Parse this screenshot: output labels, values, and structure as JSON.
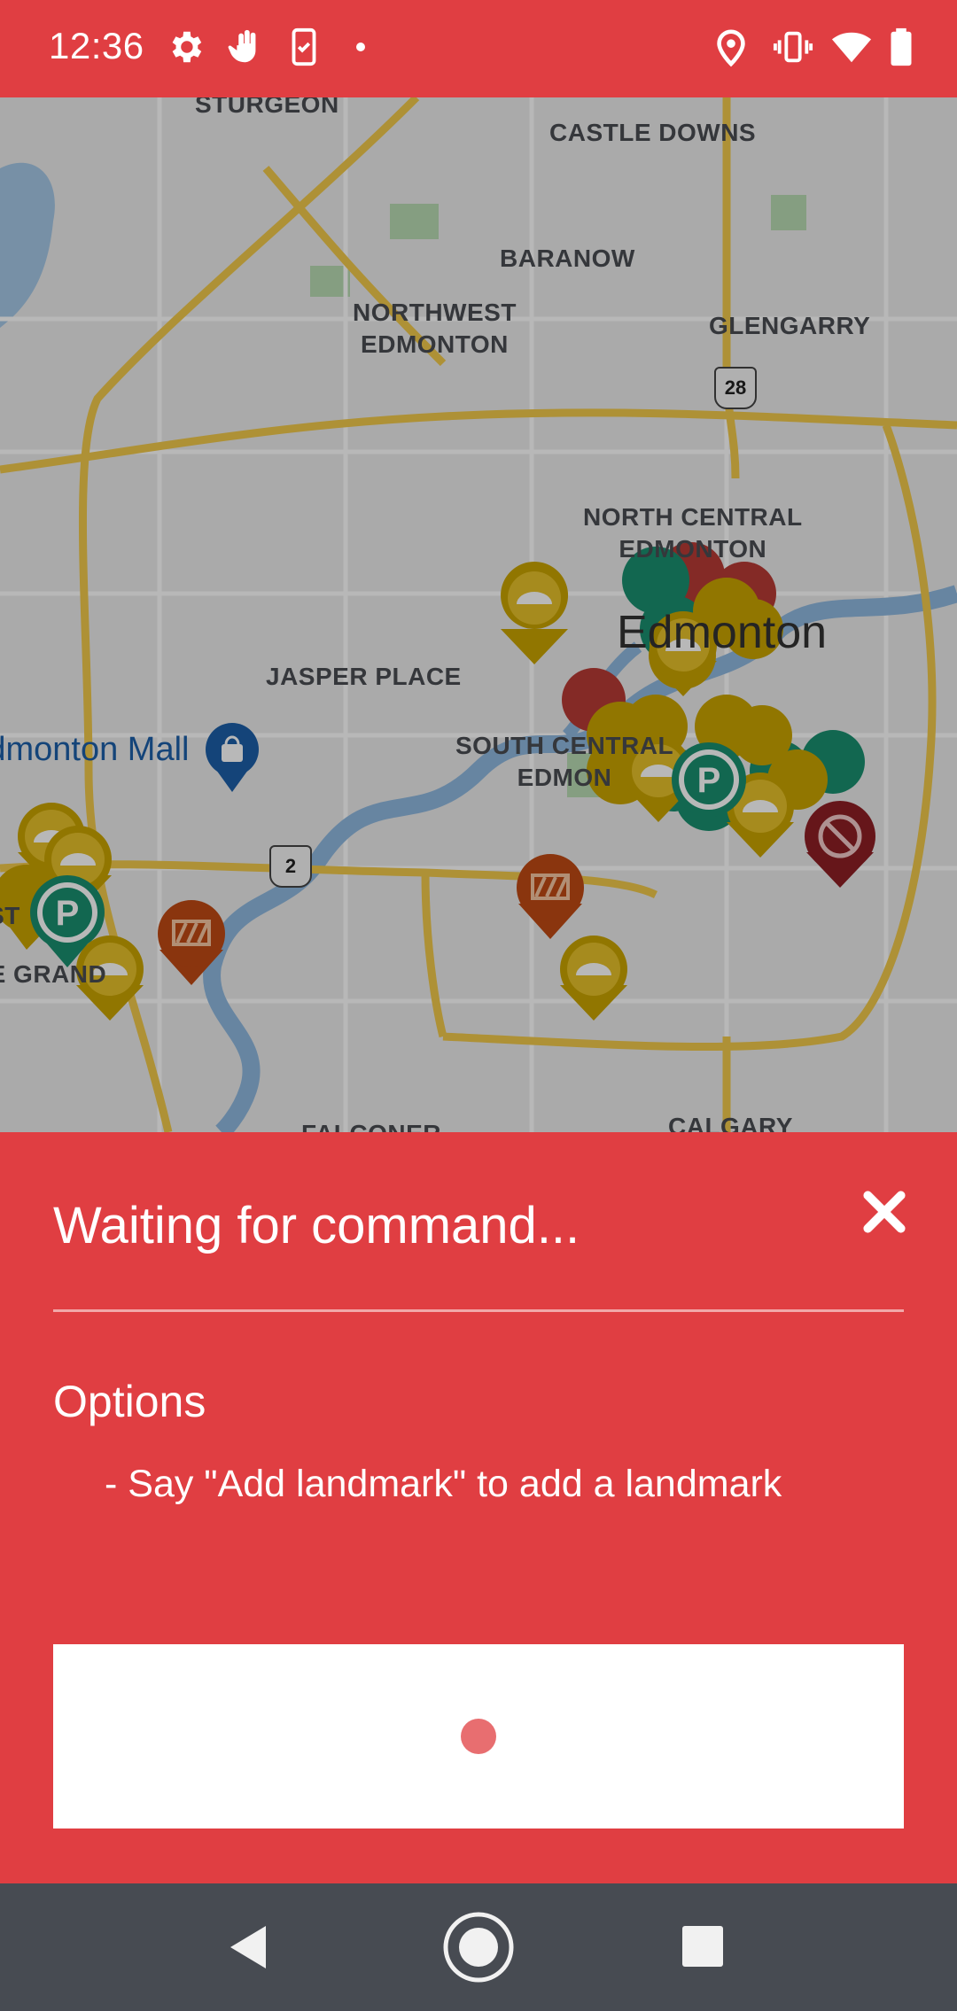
{
  "status_bar": {
    "time": "12:36",
    "left_icons": [
      "settings-gear-icon",
      "touch-gesture-icon",
      "screen-rotate-icon",
      "notification-dot-icon"
    ],
    "right_icons": [
      "location-pin-icon",
      "vibrate-icon",
      "wifi-icon",
      "battery-icon"
    ],
    "background": "#e03e42"
  },
  "map": {
    "labels": {
      "sturgeon": "STURGEON",
      "castle_downs": "CASTLE DOWNS",
      "baranow": "BARANOW",
      "northwest": "NORTHWEST\nEDMONTON",
      "glengarry": "GLENGARRY",
      "north_central": "NORTH CENTRAL\nEDMONTON",
      "edmonton": "Edmonton",
      "jasper_place": "JASPER PLACE",
      "south_central": "SOUTH CENTRAL\nEDMON",
      "mall": "Edmonton Mall",
      "west": "WEST",
      "le_grand": "LE GRAND",
      "falconer": "FALCONER",
      "calgary": "CALGARY"
    },
    "highway_shields": [
      "28",
      "2"
    ],
    "marker_colors": {
      "speed_bump": "#c9a400",
      "parking": "#1a8f70",
      "construction": "#bf4a14",
      "no_entry": "#8e1f24",
      "other_red": "#b83b35"
    }
  },
  "panel": {
    "title": "Waiting for command...",
    "options_heading": "Options",
    "option_items": [
      "- Say \"Add landmark\" to add a landmark"
    ],
    "close_icon": "close-x-icon",
    "accent": "#e03e42",
    "mic_indicator_color": "#e86e70"
  },
  "nav_bar": {
    "buttons": [
      "back-triangle-icon",
      "home-circle-icon",
      "recents-square-icon"
    ],
    "background": "#474b52"
  }
}
